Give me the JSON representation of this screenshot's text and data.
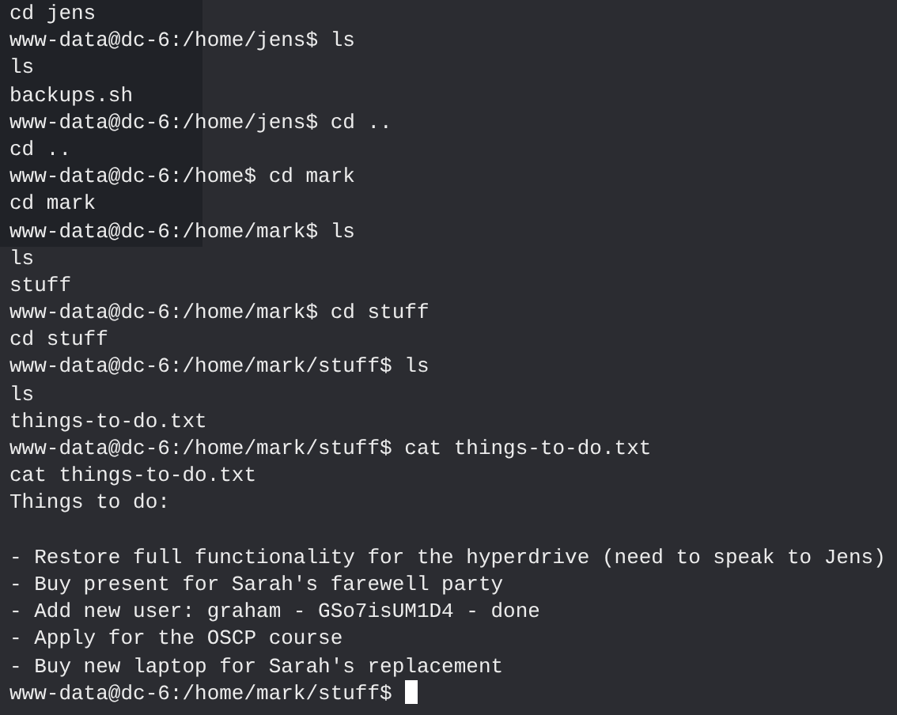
{
  "terminal": {
    "lines": [
      {
        "kind": "text",
        "text": "cd jens"
      },
      {
        "kind": "text",
        "text": "www-data@dc-6:/home/jens$ ls"
      },
      {
        "kind": "text",
        "text": "ls"
      },
      {
        "kind": "text",
        "text": "backups.sh"
      },
      {
        "kind": "text",
        "text": "www-data@dc-6:/home/jens$ cd .."
      },
      {
        "kind": "text",
        "text": "cd .."
      },
      {
        "kind": "text",
        "text": "www-data@dc-6:/home$ cd mark"
      },
      {
        "kind": "text",
        "text": "cd mark"
      },
      {
        "kind": "text",
        "text": "www-data@dc-6:/home/mark$ ls"
      },
      {
        "kind": "text",
        "text": "ls"
      },
      {
        "kind": "text",
        "text": "stuff"
      },
      {
        "kind": "text",
        "text": "www-data@dc-6:/home/mark$ cd stuff"
      },
      {
        "kind": "text",
        "text": "cd stuff"
      },
      {
        "kind": "text",
        "text": "www-data@dc-6:/home/mark/stuff$ ls"
      },
      {
        "kind": "text",
        "text": "ls"
      },
      {
        "kind": "text",
        "text": "things-to-do.txt"
      },
      {
        "kind": "text",
        "text": "www-data@dc-6:/home/mark/stuff$ cat things-to-do.txt"
      },
      {
        "kind": "text",
        "text": "cat things-to-do.txt"
      },
      {
        "kind": "text",
        "text": "Things to do:"
      },
      {
        "kind": "blank"
      },
      {
        "kind": "text",
        "text": "- Restore full functionality for the hyperdrive (need to speak to Jens)"
      },
      {
        "kind": "text",
        "text": "- Buy present for Sarah's farewell party"
      },
      {
        "kind": "text",
        "text": "- Add new user: graham - GSo7isUM1D4 - done"
      },
      {
        "kind": "text",
        "text": "- Apply for the OSCP course"
      },
      {
        "kind": "text",
        "text": "- Buy new laptop for Sarah's replacement"
      }
    ],
    "prompt": "www-data@dc-6:/home/mark/stuff$",
    "cursor": true
  }
}
